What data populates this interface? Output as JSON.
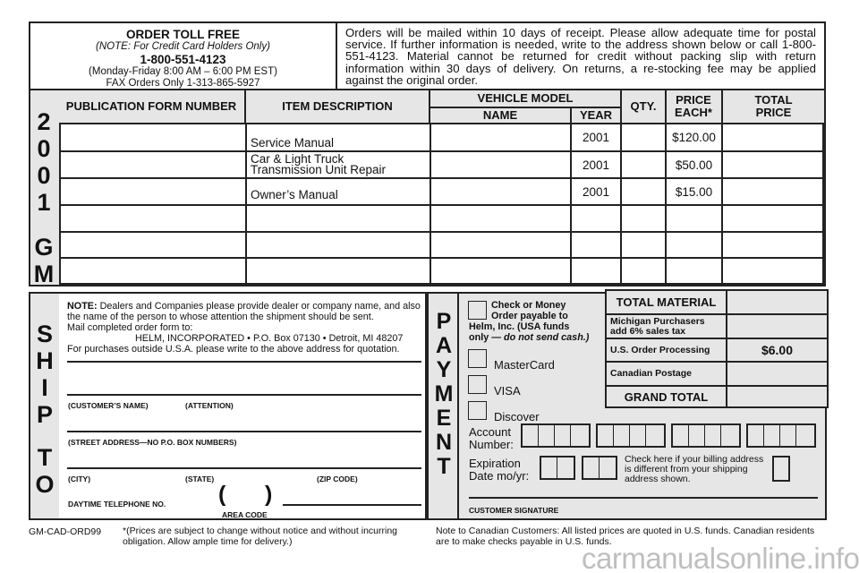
{
  "order_info": {
    "title": "ORDER TOLL FREE",
    "note": "(NOTE: For Credit Card Holders Only)",
    "phone": "1-800-551-4123",
    "hours": "(Monday-Friday 8:00 AM – 6:00 PM EST)",
    "fax": "FAX Orders Only 1-313-865-5927"
  },
  "policy_text": "Orders will be mailed within 10 days of receipt. Please allow adequate time for postal service. If further information is needed, write to the address shown below or call 1-800-551-4123. Material cannot be returned for credit without packing slip with return information within 30 days of delivery. On returns, a re-stocking fee may be applied against the original order.",
  "side_label_order": [
    "2",
    "0",
    "0",
    "1",
    "G",
    "M"
  ],
  "table": {
    "headers": {
      "publication": "PUBLICATION FORM NUMBER",
      "description": "ITEM DESCRIPTION",
      "vehicle_model": "VEHICLE MODEL",
      "name": "NAME",
      "year": "YEAR",
      "qty": "QTY.",
      "price_each": "PRICE EACH*",
      "total_price": "TOTAL PRICE"
    },
    "rows": [
      {
        "publication": "",
        "description": "Service Manual",
        "name": "",
        "year": "2001",
        "qty": "",
        "price_each": "$120.00",
        "total": ""
      },
      {
        "publication": "",
        "description": "Car & Light Truck\nTransmission Unit Repair",
        "name": "",
        "year": "2001",
        "qty": "",
        "price_each": "$50.00",
        "total": ""
      },
      {
        "publication": "",
        "description": "Owner’s Manual",
        "name": "",
        "year": "2001",
        "qty": "",
        "price_each": "$15.00",
        "total": ""
      },
      {
        "publication": "",
        "description": "",
        "name": "",
        "year": "",
        "qty": "",
        "price_each": "",
        "total": ""
      },
      {
        "publication": "",
        "description": "",
        "name": "",
        "year": "",
        "qty": "",
        "price_each": "",
        "total": ""
      },
      {
        "publication": "",
        "description": "",
        "name": "",
        "year": "",
        "qty": "",
        "price_each": "",
        "total": ""
      }
    ]
  },
  "ship_to": {
    "side_label": [
      "S",
      "H",
      "I",
      "P",
      "",
      "T",
      "O"
    ],
    "note_bold": "NOTE:",
    "note_text": " Dealers and Companies please provide dealer or company name, and also the name of the person to whose attention the shipment should be sent.",
    "mail_to": "Mail completed order form to:",
    "address": "HELM, INCORPORATED • P.O. Box 07130 • Detroit, MI 48207",
    "outside_usa": "For purchases outside U.S.A. please write to the above address for quotation.",
    "customer_name_label": "(CUSTOMER’S NAME)",
    "attention_label": "(ATTENTION)",
    "street_label": "(STREET ADDRESS—NO P.O. BOX NUMBERS)",
    "city_label": "(CITY)",
    "state_label": "(STATE)",
    "zip_label": "(ZIP CODE)",
    "phone_label": "DAYTIME TELEPHONE NO.",
    "paren_open": "(",
    "paren_close": ")",
    "area_code_label": "AREA CODE"
  },
  "payment": {
    "side_label": [
      "P",
      "A",
      "Y",
      "M",
      "E",
      "N",
      "T"
    ],
    "check_line1": "Check or Money",
    "check_line2": "Order payable to",
    "check_line3": "Helm, Inc. (USA funds",
    "check_line4_a": "only — ",
    "check_line4_b": "do not send cash.)",
    "mastercard": "MasterCard",
    "visa": "VISA",
    "discover": "Discover",
    "account_label_1": "Account",
    "account_label_2": "Number:",
    "expiration_label_1": "Expiration",
    "expiration_label_2": "Date mo/yr:",
    "billing_note": "Check here if your billing address is different from your shipping address shown.",
    "signature_label": "CUSTOMER SIGNATURE"
  },
  "totals": {
    "total_material": "TOTAL MATERIAL",
    "michigan_1": "Michigan Purchasers",
    "michigan_2": "add 6% sales tax",
    "us_processing": "U.S. Order Processing",
    "us_processing_value": "$6.00",
    "canadian_postage": "Canadian Postage",
    "grand_total": "GRAND TOTAL"
  },
  "footer": {
    "code": "GM-CAD-ORD99",
    "price_note": "*(Prices are subject to change without notice and without incurring obligation. Allow ample time for delivery.)",
    "canada_note": "Note to Canadian Customers: All listed prices are quoted in U.S. funds. Canadian residents are to make checks payable in U.S. funds."
  },
  "watermark": "carmanualsonline.info"
}
